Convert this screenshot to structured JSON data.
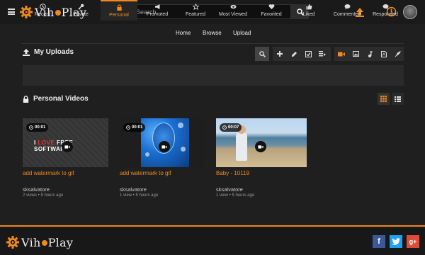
{
  "brand": {
    "name_left": "Vih",
    "name_right": "Play",
    "accent": "#ef8a1e"
  },
  "search": {
    "placeholder": "Search"
  },
  "nav": {
    "home": "Home",
    "browse": "Browse",
    "upload": "Upload"
  },
  "uploads": {
    "title": "My Uploads"
  },
  "tabs": [
    {
      "label": "Recent",
      "icon": "clock-icon"
    },
    {
      "label": "Private",
      "icon": "key-icon"
    },
    {
      "label": "Personal",
      "icon": "lock-icon"
    },
    {
      "label": "Promoted",
      "icon": "megaphone-icon"
    },
    {
      "label": "Featured",
      "icon": "star-icon"
    },
    {
      "label": "Most Viewed",
      "icon": "eye-icon"
    },
    {
      "label": "Favorited",
      "icon": "heart-icon"
    },
    {
      "label": "Liked",
      "icon": "thumbs-up-icon"
    },
    {
      "label": "Commented",
      "icon": "comment-icon"
    },
    {
      "label": "Responded",
      "icon": "reply-icon"
    }
  ],
  "section": {
    "title": "Personal Videos"
  },
  "videos": [
    {
      "duration": "00:01",
      "title": "add watermark to gif",
      "user": "sksalvatore",
      "meta": "2 views • 5 hours ago",
      "thumb_text_a": "I ",
      "thumb_text_b": "LOVE",
      "thumb_text_c": " FREE ",
      "thumb_text_d": "SOFTWARE"
    },
    {
      "duration": "00:01",
      "title": "add watermark to gif",
      "user": "sksalvatore",
      "meta": "1 view • 5 hours ago"
    },
    {
      "duration": "00:07",
      "title": "Baby - 10119",
      "user": "sksalvatore",
      "meta": "1 view • 5 hours ago"
    }
  ]
}
